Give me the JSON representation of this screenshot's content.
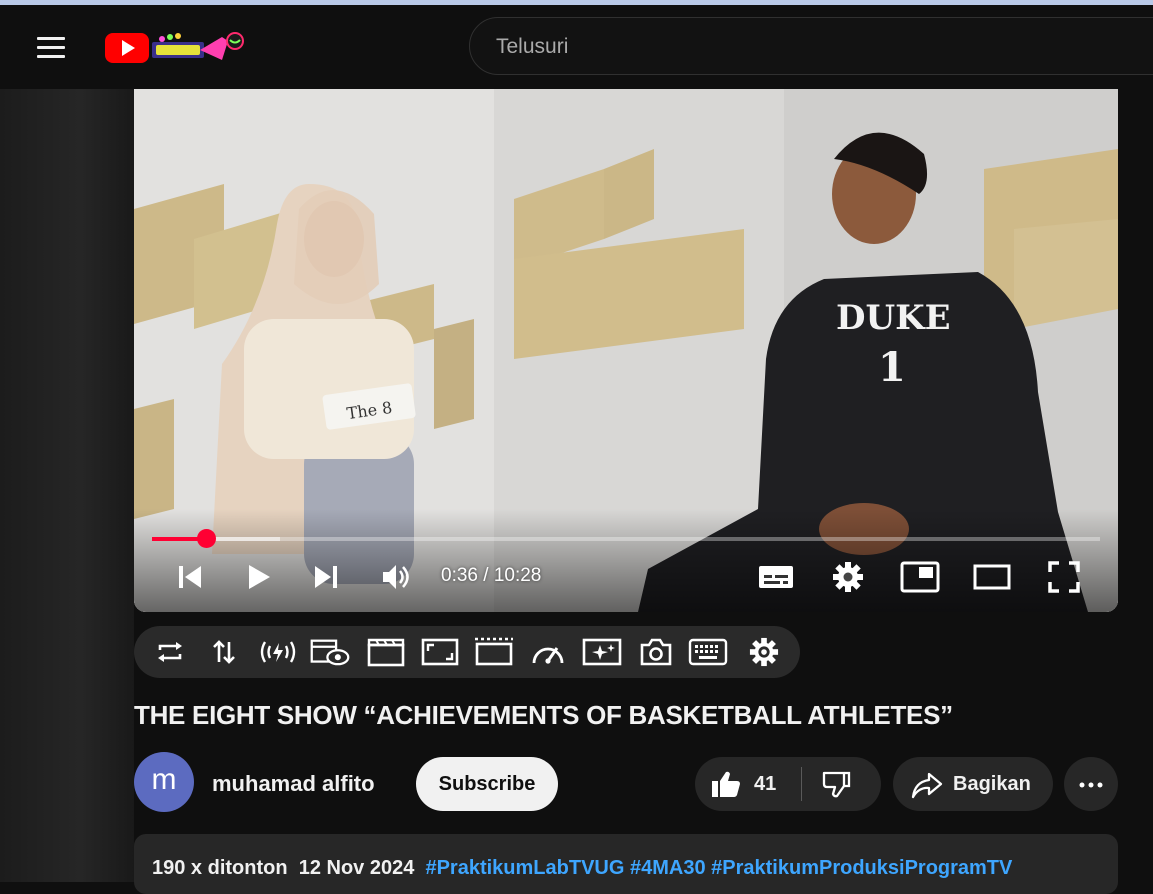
{
  "search": {
    "placeholder": "Telusuri"
  },
  "player": {
    "current_time": "0:36",
    "separator": " / ",
    "duration": "10:28",
    "progress_fraction": 0.057,
    "buffered_fraction": 0.135
  },
  "video": {
    "title": "THE EIGHT SHOW “ACHIEVEMENTS OF BASKETBALL ATHLETES”",
    "shirt_text": "DUKE",
    "shirt_number": "1",
    "paper_text": "The 8"
  },
  "channel": {
    "avatar_letter": "m",
    "name": "muhamad alfito",
    "subscribe_label": "Subscribe"
  },
  "actions": {
    "like_count": "41",
    "share_label": "Bagikan"
  },
  "description": {
    "views": "190 x ditonton",
    "date": "12 Nov 2024",
    "hashtags": [
      "#PraktikumLabTVUG",
      "#4MA30",
      "#PraktikumProduksiProgramTV"
    ]
  },
  "colors": {
    "accent": "#ff0033",
    "link": "#3ea6ff",
    "avatar": "#5c6bc0",
    "background": "#0f0f0f",
    "chip": "#272727"
  },
  "icons": {
    "masthead": [
      "menu-icon",
      "youtube-logo"
    ],
    "player_controls": [
      "previous-icon",
      "play-icon",
      "next-icon",
      "volume-icon",
      "subtitles-icon",
      "settings-icon",
      "miniplayer-icon",
      "theater-mode-icon",
      "fullscreen-icon"
    ],
    "toolbar": [
      "loop-icon",
      "sort-icon",
      "stream-icon",
      "watched-eye-icon",
      "clapperboard-icon",
      "aspect-ratio-icon",
      "cinema-mode-icon",
      "speedometer-icon",
      "enhance-icon",
      "screenshot-camera-icon",
      "keyboard-icon",
      "gear-icon"
    ],
    "actions": [
      "thumbs-up-icon",
      "thumbs-down-icon",
      "share-arrow-icon",
      "more-options-icon"
    ]
  }
}
